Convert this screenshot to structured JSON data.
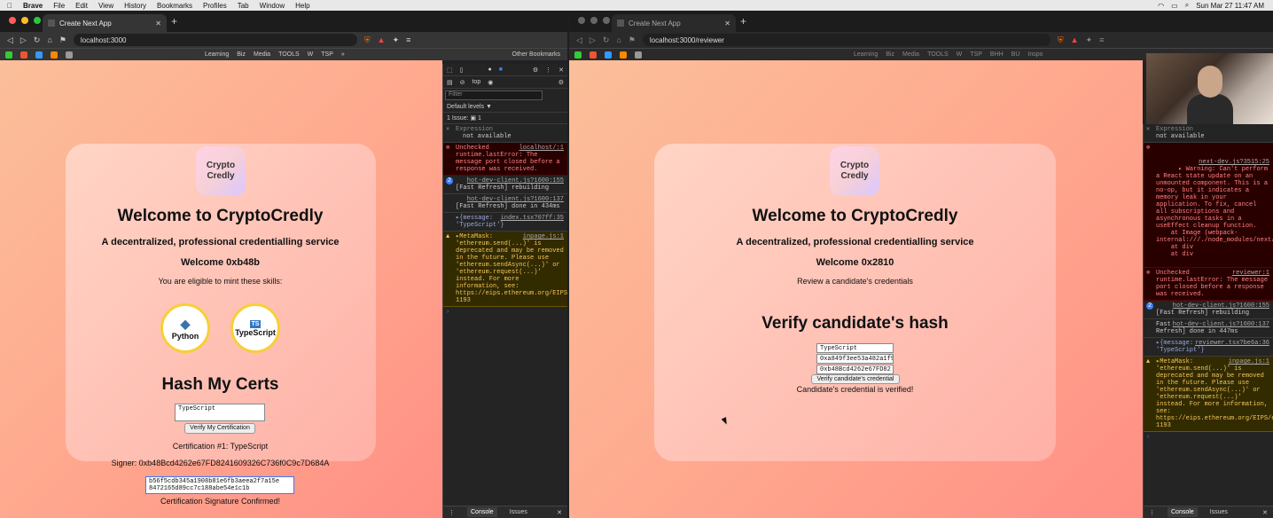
{
  "menubar": {
    "app": "Brave",
    "items": [
      "File",
      "Edit",
      "View",
      "History",
      "Bookmarks",
      "Profiles",
      "Tab",
      "Window",
      "Help"
    ],
    "clock": "Sun Mar 27  11:47 AM"
  },
  "left_window": {
    "tab_title": "Create Next App",
    "url": "localhost:3000",
    "bookmarks": [
      "Learning",
      "Biz",
      "Media",
      "TOOLS",
      "W",
      "TSP",
      "»",
      "Other Bookmarks"
    ],
    "page": {
      "logo_line1": "Crypto",
      "logo_line2": "Credly",
      "title": "Welcome to CryptoCredly",
      "subtitle": "A decentralized, professional credentialling service",
      "welcome": "Welcome 0xb48b",
      "eligible": "You are eligible to mint these skills:",
      "skills": [
        {
          "name": "Python"
        },
        {
          "name": "TypeScript"
        }
      ],
      "ts_badge": "TS",
      "hash_heading": "Hash My Certs",
      "input_value": "TypeScript",
      "verify_button": "Verify My Certification",
      "cert_line": "Certification #1: TypeScript",
      "signer_line": "Signer: 0xb48Bcd4262e67FD8241609326C736f0C9c7D684A",
      "hash_line1": "b56f5cdb345a1908b81e6fb3aeea2f7a15e",
      "hash_line2": "8472165d89cc7c188abe54e1c1b",
      "confirmed": "Certification Signature Confirmed!"
    },
    "devtools": {
      "context": "top",
      "filter_placeholder": "Filter",
      "levels": "Default levels ▼",
      "issues": "1 Issue: ▣ 1",
      "expression_label": "Expression",
      "expression_value": "not available",
      "messages": [
        {
          "type": "error",
          "src": "localhost/:1",
          "text": "Unchecked runtime.lastError: The message port closed before a response was received."
        },
        {
          "type": "info",
          "src": "hot-dev-client.js?1600:155",
          "text": "[Fast Refresh] rebuilding",
          "count": "2"
        },
        {
          "type": "info",
          "src": "hot-dev-client.js?1600:137",
          "text": "[Fast Refresh] done in 434ms"
        },
        {
          "type": "info",
          "src": "index.tsx?07ff:35",
          "text": "▸{message: 'TypeScript'}"
        },
        {
          "type": "warn",
          "src": "inpage.js:1",
          "text": "▸MetaMask: 'ethereum.send(...)' is deprecated and may be removed in the future. Please use 'ethereum.sendAsync(...)' or 'ethereum.request(...)' instead. For more information, see: https://eips.ethereum.org/EIPS/eip-1193"
        }
      ],
      "bottom_tabs": [
        "Console",
        "Issues"
      ]
    }
  },
  "right_window": {
    "tab_title": "Create Next App",
    "url": "localhost:3000/reviewer",
    "bookmarks": [
      "Learning",
      "Biz",
      "Media",
      "TOOLS",
      "W",
      "TSP",
      "BHH",
      "BU",
      "Inspo"
    ],
    "page": {
      "logo_line1": "Crypto",
      "logo_line2": "Credly",
      "title": "Welcome to CryptoCredly",
      "subtitle": "A decentralized, professional credentialling service",
      "welcome": "Welcome 0x2810",
      "review": "Review a candidate's credentials",
      "verify_heading": "Verify candidate's hash",
      "input1": "TypeScript",
      "input2": "0xa849f3ee53a482a1f9",
      "input3": "0xb48Bcd4262e67FD82",
      "verify_button": "Verify candidate's credential",
      "result": "Candidate's credential is verified!"
    },
    "devtools": {
      "expression_label": "Expression",
      "expression_value": "not available",
      "messages": [
        {
          "type": "error",
          "src": "next-dev.js?3515:25",
          "text": "▸ Warning: Can't perform a React state update on an unmounted component. This is a no-op, but it indicates a memory leak in your application. To fix, cancel all subscriptions and asynchronous tasks in a useEffect cleanup function.\n    at Image (webpack-internal:///./node_modules/next/dist/client/image.js:87:22)\n    at div\n    at div"
        },
        {
          "type": "error",
          "src": "reviewer:1",
          "text": "Unchecked runtime.lastError: The message port closed before a response was received."
        },
        {
          "type": "info",
          "src": "hot-dev-client.js?1600:155",
          "text": "[Fast Refresh] rebuilding",
          "count": "2"
        },
        {
          "type": "info",
          "src": "hot-dev-client.js?1600:137",
          "text": "Fast Refresh] done in 447ms"
        },
        {
          "type": "info",
          "src": "reviewer.tsx?be6a:36",
          "text": "▸{message: 'TypeScript'}"
        },
        {
          "type": "warn",
          "src": "inpage.js:1",
          "text": "▸MetaMask: 'ethereum.send(...)' is deprecated and may be removed in the future. Please use 'ethereum.sendAsync(...)' or 'ethereum.request(...)' instead. For more information, see: https://eips.ethereum.org/EIPS/eip-1193"
        }
      ],
      "bottom_tabs": [
        "Console",
        "Issues"
      ]
    }
  },
  "colors": {
    "accent_blue": "#3b7cff",
    "skill_ring": "#f7cf38",
    "error": "#ff8080",
    "warn": "#f2c55c"
  }
}
